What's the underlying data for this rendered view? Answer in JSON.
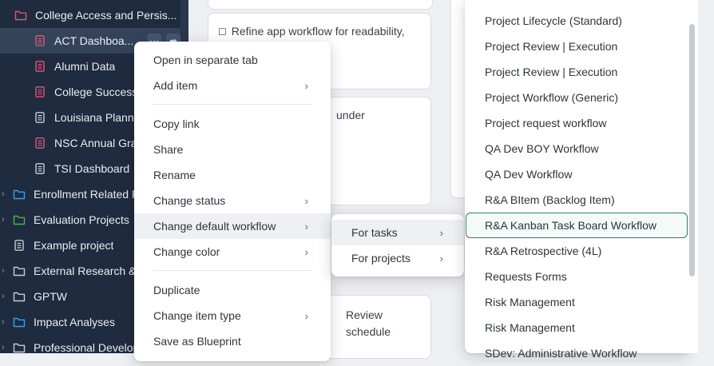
{
  "sidebar": {
    "rows": [
      {
        "label": "College Access and Persis...",
        "icon": "folder-icon",
        "color": "#e0557a",
        "indent": 1
      },
      {
        "label": "ACT Dashboa...",
        "icon": "document-icon",
        "color": "#e0557a",
        "indent": 2,
        "selected": true
      },
      {
        "label": "Alumni Data",
        "icon": "document-icon",
        "color": "#e0557a",
        "indent": 2
      },
      {
        "label": "College Success...",
        "icon": "document-icon",
        "color": "#e0557a",
        "indent": 2
      },
      {
        "label": "Louisiana Planni...",
        "icon": "document-icon",
        "color": "#c7ccd6",
        "indent": 2
      },
      {
        "label": "NSC Annual Gra...",
        "icon": "document-icon",
        "color": "#e0557a",
        "indent": 2
      },
      {
        "label": "TSI Dashboard",
        "icon": "document-icon",
        "color": "#c7ccd6",
        "indent": 2
      },
      {
        "label": "Enrollment Related P...",
        "icon": "folder-icon",
        "color": "#3b9ef0",
        "indent": 0
      },
      {
        "label": "Evaluation Projects",
        "icon": "folder-icon",
        "color": "#4cae4f",
        "indent": 0
      },
      {
        "label": "Example project",
        "icon": "document-icon",
        "color": "#c7ccd6",
        "indent": 0
      },
      {
        "label": "External Research &...",
        "icon": "folder-icon",
        "color": "#c7ccd6",
        "indent": 0
      },
      {
        "label": "GPTW",
        "icon": "folder-icon",
        "color": "#c7ccd6",
        "indent": 0
      },
      {
        "label": "Impact Analyses",
        "icon": "folder-icon",
        "color": "#3b9ef0",
        "indent": 0
      },
      {
        "label": "Professional Develop...",
        "icon": "folder-icon",
        "color": "#c7ccd6",
        "indent": 0
      }
    ]
  },
  "board": {
    "card1_text": "Refine app workflow for readability,",
    "card2_text": "under",
    "card3_text": "Review schedule"
  },
  "context_menu": {
    "items": [
      {
        "label": "Open in separate tab",
        "submenu": false
      },
      {
        "label": "Add item",
        "submenu": true
      },
      {
        "label": "Copy link",
        "submenu": false
      },
      {
        "label": "Share",
        "submenu": false
      },
      {
        "label": "Rename",
        "submenu": false
      },
      {
        "label": "Change status",
        "submenu": true
      },
      {
        "label": "Change default workflow",
        "submenu": true,
        "hover": true
      },
      {
        "label": "Change color",
        "submenu": true
      },
      {
        "label": "Duplicate",
        "submenu": false
      },
      {
        "label": "Change item type",
        "submenu": true
      },
      {
        "label": "Save as Blueprint",
        "submenu": false
      }
    ]
  },
  "workflow_target_menu": {
    "items": [
      {
        "label": "For tasks",
        "hover": true
      },
      {
        "label": "For projects",
        "hover": false
      }
    ]
  },
  "workflow_list": {
    "items": [
      "Project Lifecycle (Standard)",
      "Project Review | Execution",
      "Project Review | Execution",
      "Project Workflow (Generic)",
      "Project request workflow",
      "QA Dev BOY Workflow",
      "QA Dev Workflow",
      "R&A BItem (Backlog Item)",
      "R&A Kanban Task Board Workflow",
      "R&A Retrospective (4L)",
      "Requests Forms",
      "Risk Management",
      "Risk Management",
      "SDev: Administrative Workflow"
    ],
    "selected": "R&A Kanban Task Board Workflow",
    "accent": "#2f7f6c"
  }
}
